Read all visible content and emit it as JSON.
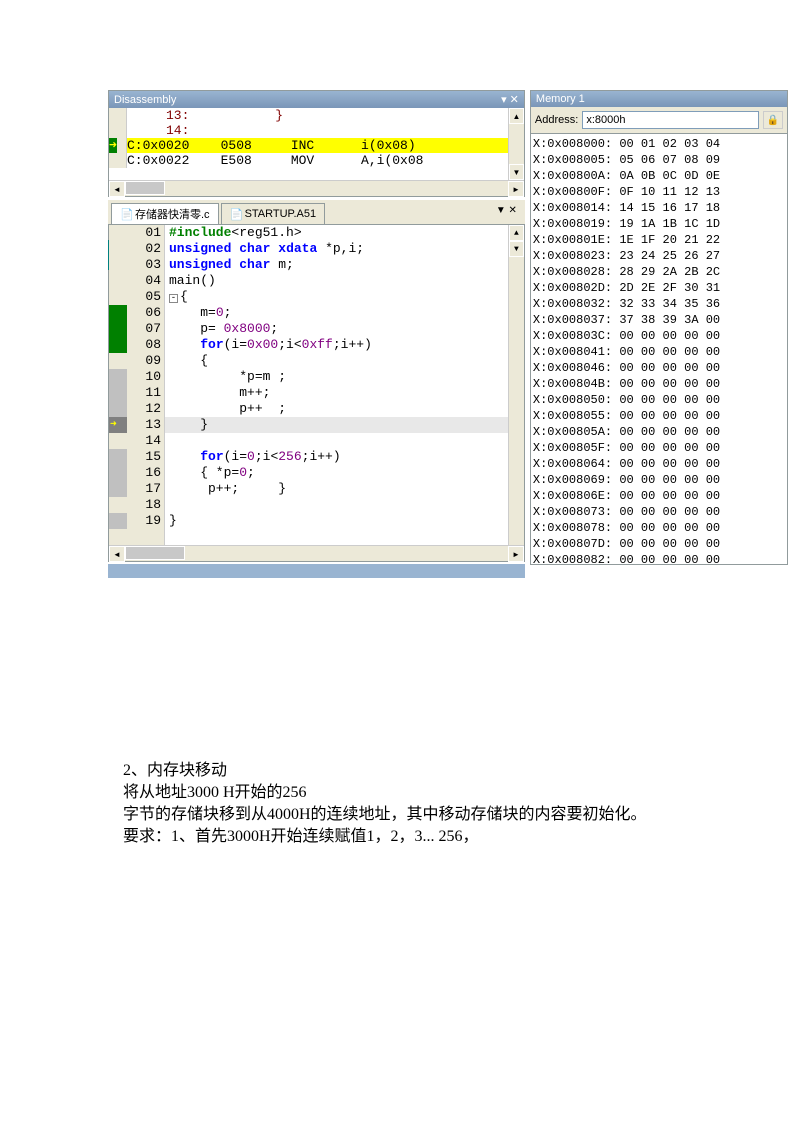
{
  "disasm": {
    "title": "Disassembly",
    "lines": [
      {
        "text": "     13:           }",
        "cls": "red"
      },
      {
        "text": "     14:",
        "cls": "red"
      },
      {
        "text": "C:0x0020    0508     INC      i(0x08)",
        "cls": "yellow",
        "arrow": true
      },
      {
        "text": "C:0x0022    E508     MOV      A,i(0x08",
        "cls": ""
      }
    ]
  },
  "tabs": {
    "t1": "存储器快清零.c",
    "t2": "STARTUP.A51"
  },
  "code": {
    "lines": [
      {
        "n": "01",
        "bp": "",
        "html": "<span class='pp'>#include</span>&lt;reg51.h&gt;"
      },
      {
        "n": "02",
        "bp": "",
        "html": "<span class='kw'>unsigned</span> <span class='kw'>char</span> <span class='kw'>xdata</span> *p,i;"
      },
      {
        "n": "03",
        "bp": "",
        "html": "<span class='kw'>unsigned</span> <span class='kw'>char</span> m;"
      },
      {
        "n": "04",
        "bp": "",
        "html": "main()"
      },
      {
        "n": "05",
        "bp": "",
        "html": "<span class='minus-box'>-</span>{"
      },
      {
        "n": "06",
        "bp": "green",
        "html": "    m=<span class='num'>0</span>;"
      },
      {
        "n": "07",
        "bp": "green",
        "html": "    p= <span class='num'>0x8000</span>;"
      },
      {
        "n": "08",
        "bp": "green",
        "html": "    <span class='kw'>for</span>(i=<span class='num'>0x00</span>;i&lt;<span class='num'>0xff</span>;i++)"
      },
      {
        "n": "09",
        "bp": "",
        "html": "    {"
      },
      {
        "n": "10",
        "bp": "grey",
        "html": "         *p=m ;"
      },
      {
        "n": "11",
        "bp": "grey",
        "html": "         m++;"
      },
      {
        "n": "12",
        "bp": "grey",
        "html": "         p++  ;"
      },
      {
        "n": "13",
        "bp": "arrow",
        "html": "    }",
        "cur": true
      },
      {
        "n": "14",
        "bp": "",
        "html": ""
      },
      {
        "n": "15",
        "bp": "grey",
        "html": "    <span class='kw'>for</span>(i=<span class='num'>0</span>;i&lt;<span class='num'>256</span>;i++)"
      },
      {
        "n": "16",
        "bp": "grey",
        "html": "    { *p=<span class='num'>0</span>;"
      },
      {
        "n": "17",
        "bp": "grey",
        "html": "     p++;     }"
      },
      {
        "n": "18",
        "bp": "",
        "html": ""
      },
      {
        "n": "19",
        "bp": "grey",
        "html": "}"
      }
    ]
  },
  "memory": {
    "title": "Memory 1",
    "addrLabel": "Address:",
    "addrVal": "x:8000h",
    "rows": [
      "X:0x008000: 00 01 02 03 04",
      "X:0x008005: 05 06 07 08 09",
      "X:0x00800A: 0A 0B 0C 0D 0E",
      "X:0x00800F: 0F 10 11 12 13",
      "X:0x008014: 14 15 16 17 18",
      "X:0x008019: 19 1A 1B 1C 1D",
      "X:0x00801E: 1E 1F 20 21 22",
      "X:0x008023: 23 24 25 26 27",
      "X:0x008028: 28 29 2A 2B 2C",
      "X:0x00802D: 2D 2E 2F 30 31",
      "X:0x008032: 32 33 34 35 36",
      "X:0x008037: 37 38 39 3A 00",
      "X:0x00803C: 00 00 00 00 00",
      "X:0x008041: 00 00 00 00 00",
      "X:0x008046: 00 00 00 00 00",
      "X:0x00804B: 00 00 00 00 00",
      "X:0x008050: 00 00 00 00 00",
      "X:0x008055: 00 00 00 00 00",
      "X:0x00805A: 00 00 00 00 00",
      "X:0x00805F: 00 00 00 00 00",
      "X:0x008064: 00 00 00 00 00",
      "X:0x008069: 00 00 00 00 00",
      "X:0x00806E: 00 00 00 00 00",
      "X:0x008073: 00 00 00 00 00",
      "X:0x008078: 00 00 00 00 00",
      "X:0x00807D: 00 00 00 00 00",
      "X:0x008082: 00 00 00 00 00"
    ]
  },
  "doc": {
    "l1": "2、内存块移动",
    "l2": "将从地址3000 H开始的256",
    "l3": "字节的存储块移到从4000H的连续地址，其中移动存储块的内容要初始化。",
    "l4": "要求：1、首先3000H开始连续赋值1，2，3... 256，"
  }
}
